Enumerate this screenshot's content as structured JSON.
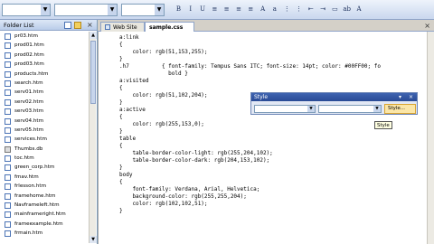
{
  "toolbar": {
    "buttons": [
      {
        "label": "B",
        "icon": "bold-icon"
      },
      {
        "label": "I",
        "icon": "italic-icon"
      },
      {
        "label": "U",
        "icon": "underline-icon"
      },
      {
        "label": "≡",
        "icon": "align-left-icon"
      },
      {
        "label": "≡",
        "icon": "align-center-icon"
      },
      {
        "label": "≡",
        "icon": "align-right-icon"
      },
      {
        "label": "≡",
        "icon": "justify-icon"
      },
      {
        "label": "A",
        "icon": "increase-font-icon"
      },
      {
        "label": "a",
        "icon": "decrease-font-icon"
      },
      {
        "label": "⋮",
        "icon": "numbered-list-icon"
      },
      {
        "label": "⋮",
        "icon": "bullet-list-icon"
      },
      {
        "label": "⇤",
        "icon": "outdent-icon"
      },
      {
        "label": "⇥",
        "icon": "indent-icon"
      },
      {
        "label": "▭",
        "icon": "border-icon"
      },
      {
        "label": "ab",
        "icon": "highlight-icon"
      },
      {
        "label": "A",
        "icon": "font-color-icon"
      }
    ]
  },
  "folder_list": {
    "title": "Folder List",
    "files": [
      {
        "name": "pr03.htm"
      },
      {
        "name": "prod01.htm"
      },
      {
        "name": "prod02.htm"
      },
      {
        "name": "prod03.htm"
      },
      {
        "name": "products.htm"
      },
      {
        "name": "search.htm"
      },
      {
        "name": "serv01.htm"
      },
      {
        "name": "serv02.htm"
      },
      {
        "name": "serv03.htm"
      },
      {
        "name": "serv04.htm"
      },
      {
        "name": "serv05.htm"
      },
      {
        "name": "services.htm"
      },
      {
        "name": "Thumbs.db"
      },
      {
        "name": "toc.htm"
      },
      {
        "name": "green_corp.htm"
      },
      {
        "name": "fmav.htm"
      },
      {
        "name": "frlesson.htm"
      },
      {
        "name": "framehome.htm"
      },
      {
        "name": "Navframeleft.htm"
      },
      {
        "name": "mainframeright.htm"
      },
      {
        "name": "frameexample.htm"
      },
      {
        "name": "frmain.htm"
      }
    ]
  },
  "tabs": [
    {
      "label": "Web Site"
    },
    {
      "label": "sample.css"
    }
  ],
  "code_lines": [
    {
      "text": "a:link"
    },
    {
      "text": "{"
    },
    {
      "text": "    color: rgb(51,153,255);"
    },
    {
      "text": "}"
    },
    {
      "text": ".h7          { font-family: Tempus Sans ITC; font-size: 14pt; color: #00FF00; fo"
    },
    {
      "text": "               bold }"
    },
    {
      "text": "a:visited"
    },
    {
      "text": "{"
    },
    {
      "text": "    color: rgb(51,102,204);"
    },
    {
      "text": "}"
    },
    {
      "text": "a:active"
    },
    {
      "text": "{"
    },
    {
      "text": "    color: rgb(255,153,0);"
    },
    {
      "text": "}"
    },
    {
      "text": "table"
    },
    {
      "text": "{"
    },
    {
      "text": "    table-border-color-light: rgb(255,204,102);"
    },
    {
      "text": "    table-border-color-dark: rgb(204,153,102);"
    },
    {
      "text": "}"
    },
    {
      "text": "body"
    },
    {
      "text": "{"
    },
    {
      "text": "    font-family: Verdana, Arial, Helvetica;"
    },
    {
      "text": "    background-color: rgb(255,255,204);"
    },
    {
      "text": "    color: rgb(102,102,51);"
    },
    {
      "text": "}"
    },
    {
      "text": ""
    },
    {
      "text": ""
    },
    {
      "text": ""
    },
    {
      "text": ""
    }
  ],
  "style_toolbar": {
    "title": "Style",
    "button_label": "Style...",
    "tooltip": "Style"
  }
}
